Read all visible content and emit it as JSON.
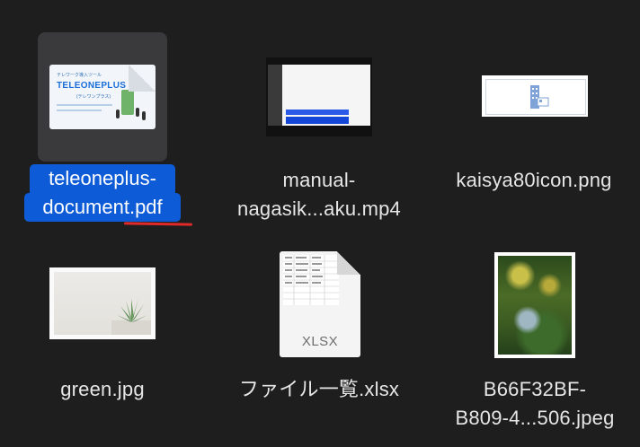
{
  "files": [
    {
      "name_line1": "teleoneplus-",
      "name_line2": "document.pdf",
      "selected": true,
      "kind": "pdf",
      "thumb": {
        "small": "テレワーク導入ツール",
        "title": "TELEONEPLUS",
        "sub": "(テレワンプラス)"
      }
    },
    {
      "name_line1": "manual-",
      "name_line2": "nagasik...aku.mp4",
      "kind": "video"
    },
    {
      "name_line1": "kaisya80icon.png",
      "name_line2": "",
      "kind": "image"
    },
    {
      "name_line1": "green.jpg",
      "name_line2": "",
      "kind": "image"
    },
    {
      "name_line1": "ファイル一覧.xlsx",
      "name_line2": "",
      "kind": "spreadsheet",
      "badge": "XLSX"
    },
    {
      "name_line1": "B66F32BF-",
      "name_line2": "B809-4...506.jpeg",
      "kind": "image"
    }
  ],
  "colors": {
    "background": "#1e1e1e",
    "selection": "#0d5bd6",
    "annotation_underline": "#e02a2a"
  }
}
